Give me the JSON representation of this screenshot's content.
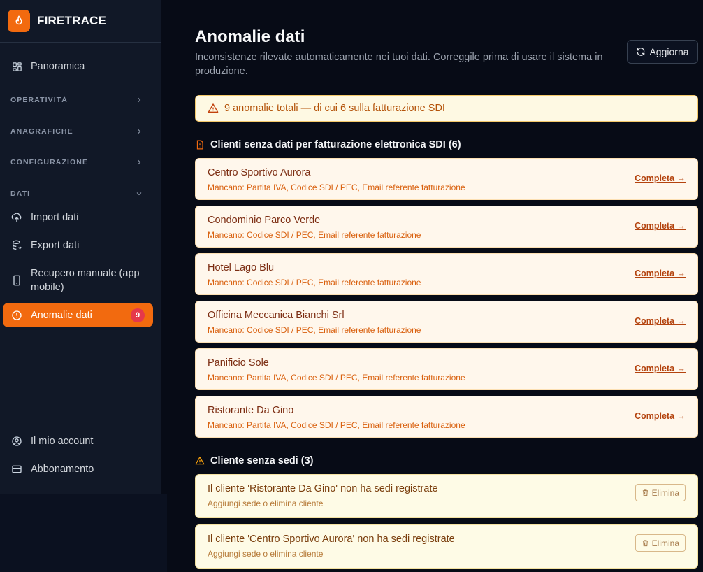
{
  "app": {
    "name": "FIRETRACE"
  },
  "sidebar": {
    "overview": "Panoramica",
    "sections": {
      "operativita": "OPERATIVITÀ",
      "anagrafiche": "ANAGRAFICHE",
      "configurazione": "CONFIGURAZIONE",
      "dati": "DATI"
    },
    "dati_items": {
      "import": "Import dati",
      "export": "Export dati",
      "manual_recovery": "Recupero manuale (app mobile)",
      "anomalies": "Anomalie dati",
      "anomalies_badge": "9"
    },
    "footer": {
      "account": "Il mio account",
      "subscription": "Abbonamento"
    }
  },
  "header": {
    "title": "Anomalie dati",
    "subtitle": "Inconsistenze rilevate automaticamente nei tuoi dati. Correggile prima di usare il sistema in produzione.",
    "refresh_label": "Aggiorna"
  },
  "summary": "9 anomalie totali — di cui 6 sulla fatturazione SDI",
  "groups": {
    "sdi": {
      "title": "Clienti senza dati per fatturazione elettronica SDI (6)",
      "action_label": "Completa →",
      "items": [
        {
          "name": "Centro Sportivo Aurora",
          "missing": "Mancano: Partita IVA, Codice SDI / PEC, Email referente fatturazione"
        },
        {
          "name": "Condominio Parco Verde",
          "missing": "Mancano: Codice SDI / PEC, Email referente fatturazione"
        },
        {
          "name": "Hotel Lago Blu",
          "missing": "Mancano: Codice SDI / PEC, Email referente fatturazione"
        },
        {
          "name": "Officina Meccanica Bianchi Srl",
          "missing": "Mancano: Codice SDI / PEC, Email referente fatturazione"
        },
        {
          "name": "Panificio Sole",
          "missing": "Mancano: Partita IVA, Codice SDI / PEC, Email referente fatturazione"
        },
        {
          "name": "Ristorante Da Gino",
          "missing": "Mancano: Partita IVA, Codice SDI / PEC, Email referente fatturazione"
        }
      ]
    },
    "no_sites": {
      "title": "Cliente senza sedi (3)",
      "action_label": "Elimina",
      "items": [
        {
          "name": "Il cliente 'Ristorante Da Gino' non ha sedi registrate",
          "hint": "Aggiungi sede o elimina cliente"
        },
        {
          "name": "Il cliente 'Centro Sportivo Aurora' non ha sedi registrate",
          "hint": "Aggiungi sede o elimina cliente"
        }
      ]
    }
  },
  "colors": {
    "accent": "#f26a0f",
    "badge": "#e5384b",
    "warning_text": "#b45309"
  }
}
